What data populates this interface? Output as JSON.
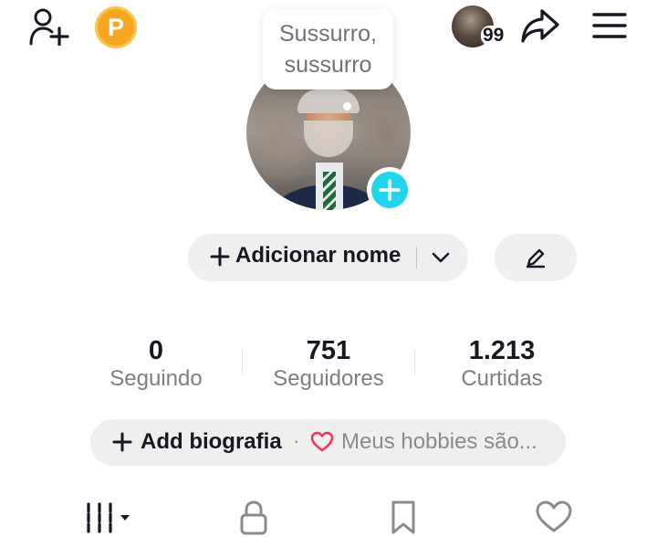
{
  "tooltip": {
    "line1": "Sussurro,",
    "line2": "sussurro"
  },
  "header": {
    "coin_letter": "P",
    "viewer_count": "99"
  },
  "profile": {
    "add_name_label": "Adicionar nome"
  },
  "stats": [
    {
      "value": "0",
      "label": "Seguindo"
    },
    {
      "value": "751",
      "label": "Seguidores"
    },
    {
      "value": "1.213",
      "label": "Curtidas"
    }
  ],
  "bio": {
    "add_label": "Add biografia",
    "separator": "·",
    "hint": "Meus hobbies são..."
  },
  "tabs": [
    {
      "icon": "grid-icon"
    },
    {
      "icon": "lock-icon"
    },
    {
      "icon": "bookmark-icon"
    },
    {
      "icon": "heart-icon"
    }
  ],
  "colors": {
    "accent": "#20d5ec",
    "coin": "#f5a623",
    "heart": "#fe2c55",
    "pill": "#efefef"
  }
}
